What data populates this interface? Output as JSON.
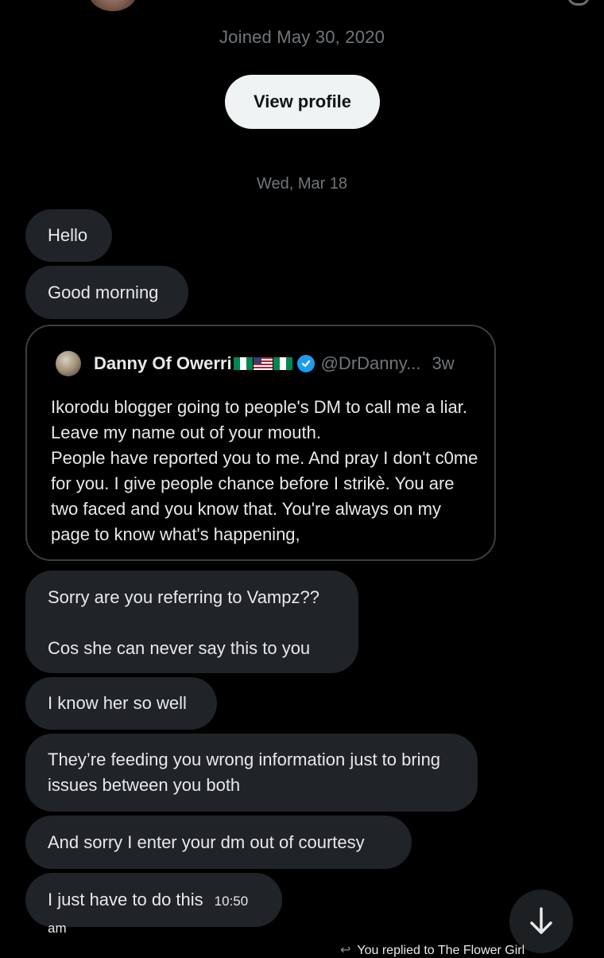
{
  "header": {
    "joined_text": "Joined May 30, 2020",
    "view_profile_label": "View profile"
  },
  "conversation": {
    "date_separator": "Wed, Mar 18",
    "messages": [
      {
        "text": "Hello"
      },
      {
        "text": "Good morning"
      },
      {
        "text": "Sorry are you referring to Vampz??\n\nCos she can never say this to you"
      },
      {
        "text": "I know her so well"
      },
      {
        "text": "They’re feeding you wrong information just to bring issues between you both"
      },
      {
        "text": "And sorry I enter your dm out of courtesy"
      },
      {
        "text": "I just have to do this",
        "timestamp": "10:50 am"
      }
    ],
    "quoted_post": {
      "author_name": "Danny Of Owerri",
      "author_flags": [
        "ng",
        "us",
        "ng"
      ],
      "verified": true,
      "handle": "@DrDanny...",
      "time_ago": "3w",
      "body": "Ikorodu blogger going to people's DM to call me a liar. Leave my name out of your mouth.\nPeople have reported you to me. And pray I don't c0me for you. I give people chance before I strikè. You are two faced and you know that. You're always on my page to know what's happening,"
    }
  },
  "footer": {
    "replied_text": "You replied to The Flower Girl",
    "scroll_button_icon": "arrow-down-icon"
  },
  "colors": {
    "background": "#000000",
    "bubble": "#202327",
    "text": "#e7e9ea",
    "muted": "#71767b",
    "verified": "#1d9bf0"
  }
}
